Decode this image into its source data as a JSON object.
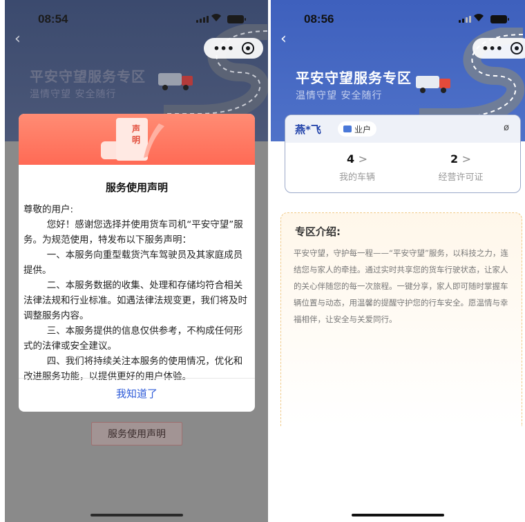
{
  "left_screen": {
    "status": {
      "time": "08:54"
    },
    "banner": {
      "title": "平安守望服务专区",
      "subtitle": "温情守望  安全随行"
    },
    "modal": {
      "stamp_text": "声明",
      "title": "服务使用声明",
      "greeting": "尊敬的用户:",
      "paragraphs": [
        "您好！感谢您选择并使用货车司机“平安守望”服务。为规范使用，特发布以下服务声明：",
        "一、本服务向重型载货汽车驾驶员及其家庭成员提供。",
        "二、本服务数据的收集、处理和存储均符合相关法律法规和行业标准。如遇法律法规变更，我们将及时调整服务内容。",
        "三、本服务提供的信息仅供参考，不构成任何形式的法律或安全建议。",
        "四、我们将持续关注本服务的使用情况，优化和改进服务功能，以提供更好的用户体验。"
      ],
      "confirm_label": "我知道了"
    },
    "underlying_button": "服务使用声明"
  },
  "right_screen": {
    "status": {
      "time": "08:56"
    },
    "banner": {
      "title": "平安守望服务专区",
      "subtitle": "温情守望  安全随行"
    },
    "user_card": {
      "name": "燕*飞",
      "role_badge": "业户",
      "stats": [
        {
          "value": "4",
          "label": "我的车辆"
        },
        {
          "value": "2",
          "label": "经营许可证"
        }
      ]
    },
    "intro": {
      "title": "专区介绍:",
      "text": "平安守望，守护每一程——“平安守望”服务，以科技之力，连结您与家人的牵挂。通过实时共享您的货车行驶状态，让家人的关心伴随您的每一次旅程。一键分享，家人即可随时掌握车辆位置与动态，用温馨的提醒守护您的行车安全。愿温情与幸福相伴，让安全与关爱同行。"
    }
  },
  "icons": {
    "back": "chevron-left-icon",
    "capsule_more": "more-dots-icon",
    "capsule_close": "target-circle-icon",
    "badge_icon": "id-card-icon",
    "eye_icon": "eye-slash-icon",
    "stamp_icon": "quill-feather-icon"
  },
  "colors": {
    "brand_blue": "#3f5fb8",
    "link_blue": "#2e5bd8",
    "modal_header": "#ff6f58",
    "intro_border": "#f0c986"
  }
}
